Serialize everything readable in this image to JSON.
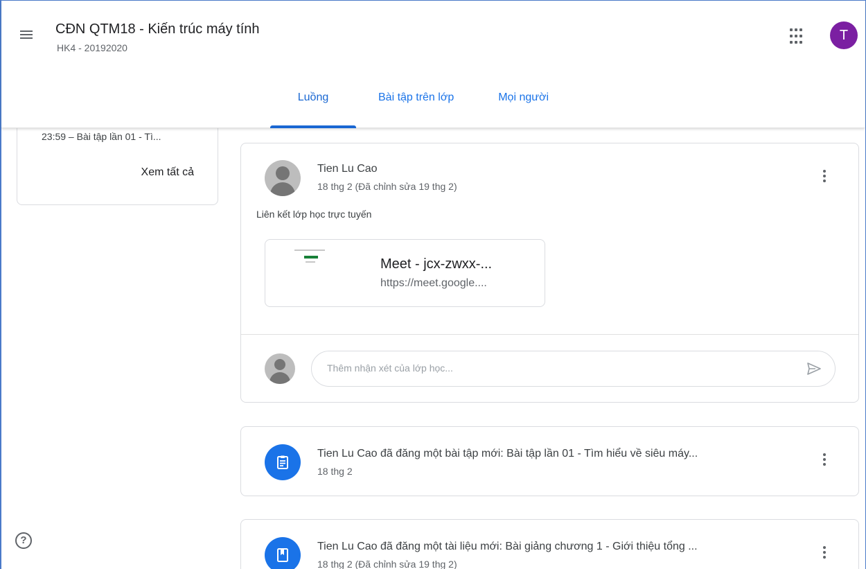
{
  "header": {
    "class_title": "CĐN QTM18 - Kiến trúc máy tính",
    "class_subtitle": "HK4 - 20192020",
    "avatar_letter": "T",
    "tabs": [
      {
        "label": "Luồng",
        "active": true
      },
      {
        "label": "Bài tập trên lớp",
        "active": false
      },
      {
        "label": "Mọi người",
        "active": false
      }
    ]
  },
  "upcoming": {
    "item": "23:59 – Bài tập lần 01 - Tì...",
    "view_all": "Xem tất cả"
  },
  "post": {
    "author": "Tien Lu Cao",
    "date": "18 thg 2 (Đã chỉnh sửa 19 thg 2)",
    "text": "Liên kết lớp học trực tuyến",
    "link": {
      "title": "Meet - jcx-zwxx-...",
      "url": "https://meet.google...."
    },
    "comment_placeholder": "Thêm nhận xét của lớp học..."
  },
  "stream": [
    {
      "type": "assignment",
      "title": "Tien Lu Cao đã đăng một bài tập mới: Bài tập lần 01 - Tìm hiểu về siêu máy...",
      "date": "18 thg 2"
    },
    {
      "type": "material",
      "title": "Tien Lu Cao đã đăng một tài liệu mới: Bài giảng chương 1 - Giới thiệu tổng ...",
      "date": "18 thg 2 (Đã chỉnh sửa 19 thg 2)"
    }
  ],
  "colors": {
    "accent": "#1a73e8",
    "avatar_bg": "#7b1fa2",
    "border": "#dadce0"
  },
  "icons": {
    "menu": "hamburger-menu-icon",
    "apps": "apps-grid-icon",
    "more": "more-vert-icon",
    "send": "send-icon",
    "assignment": "assignment-icon",
    "material": "book-icon",
    "help": "help-icon"
  }
}
